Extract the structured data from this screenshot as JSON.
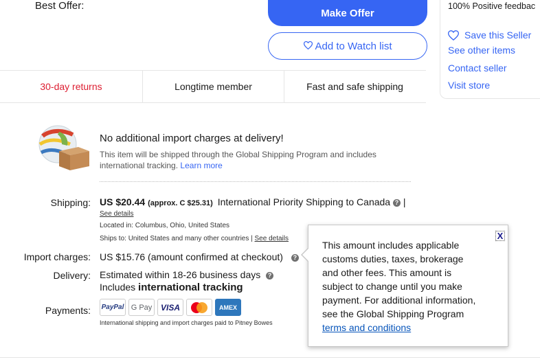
{
  "offer": {
    "best_offer_label": "Best Offer:",
    "make_offer": "Make Offer",
    "watch": "Add to Watch list"
  },
  "seller": {
    "positive": "100% Positive feedbac",
    "save": "Save this Seller",
    "see_items": "See other items",
    "contact": "Contact seller",
    "visit": "Visit store"
  },
  "tabs": [
    "30-day returns",
    "Longtime member",
    "Fast and safe shipping"
  ],
  "import_notice": {
    "title": "No additional import charges at delivery!",
    "body": "This item will be shipped through the Global Shipping Program and includes",
    "body2": "international tracking.",
    "learn_more": "Learn more"
  },
  "shipping": {
    "label": "Shipping:",
    "price": "US $20.44",
    "approx": "(approx. C $25.31)",
    "service": "International Priority Shipping to Canada",
    "sep": "|",
    "see_details": "See details",
    "located_label": "Located in:",
    "located": "Columbus, Ohio, United States",
    "ships_label": "Ships to:",
    "ships": "United States and many other countries |",
    "ships_details": "See details"
  },
  "import_charges": {
    "label": "Import charges:",
    "value": "US $15.76 (amount confirmed at checkout)"
  },
  "delivery": {
    "label": "Delivery:",
    "estimate": "Estimated within 18-26 business days",
    "includes": "Includes",
    "tracking": "international tracking"
  },
  "payments": {
    "label": "Payments:",
    "methods": [
      "PayPal",
      "G Pay",
      "VISA",
      "Mastercard",
      "AMEX"
    ],
    "note": "International shipping and import charges paid to Pitney Bowes"
  },
  "tooltip": {
    "close": "X",
    "lines": [
      "This amount includes applicable",
      "customs duties, taxes, brokerage",
      "and other fees. This amount is",
      "subject to change until you make",
      "payment. For additional information,",
      "see the Global Shipping Program"
    ],
    "link": "terms and conditions"
  },
  "colors": {
    "accent": "#3665f3",
    "returns": "#dd1e31"
  }
}
